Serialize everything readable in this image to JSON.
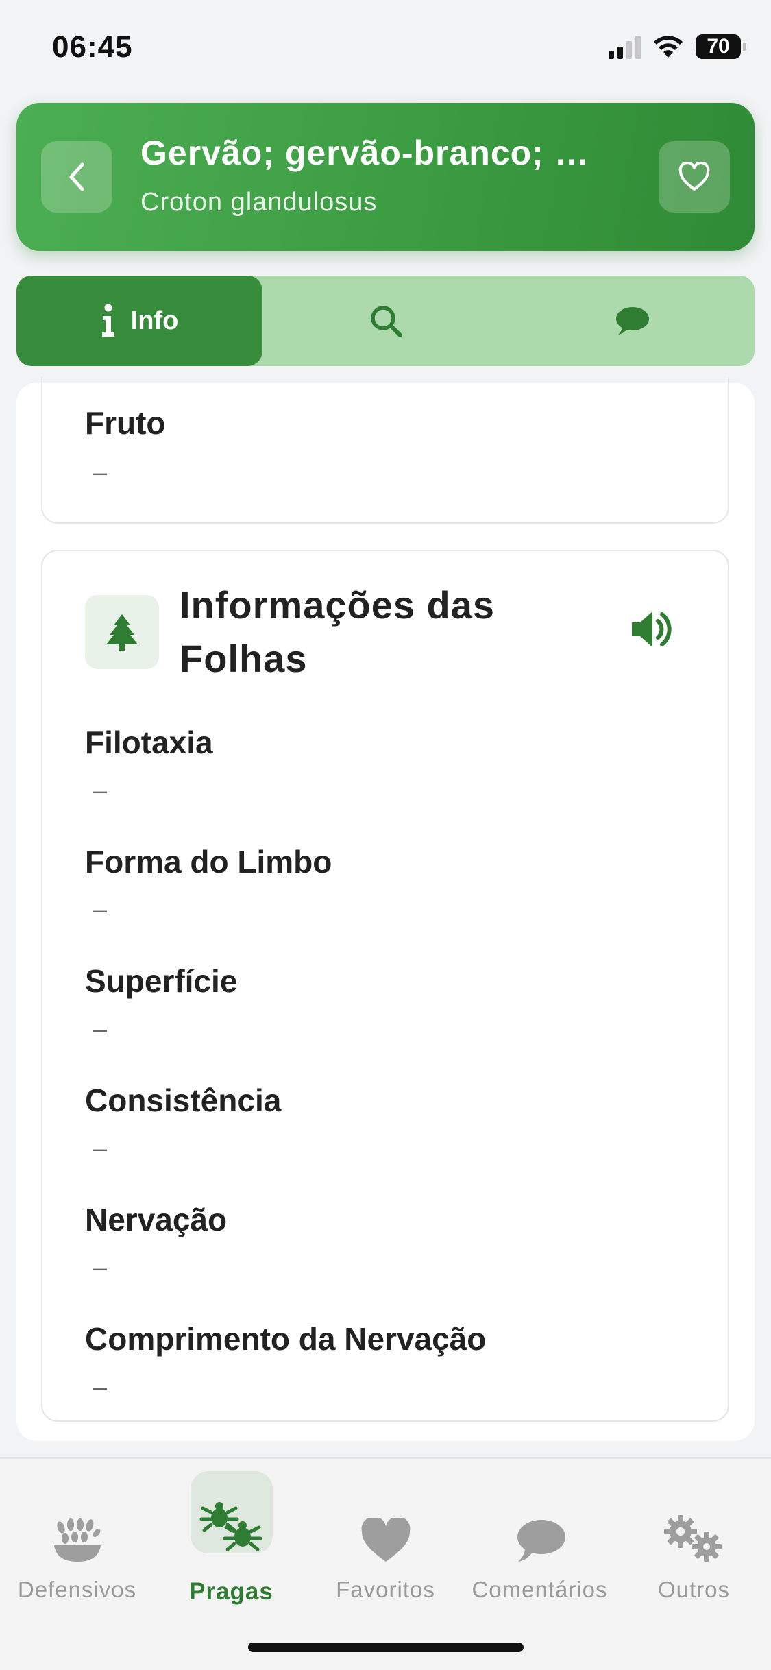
{
  "status_bar": {
    "time": "06:45",
    "battery": "70"
  },
  "header": {
    "title": "Gervão; gervão-branco; …",
    "subtitle": "Croton glandulosus"
  },
  "tabs": [
    {
      "label": "Info",
      "icon": "info-icon",
      "active": true
    },
    {
      "label": "",
      "icon": "search-icon",
      "active": false
    },
    {
      "label": "",
      "icon": "comment-icon",
      "active": false
    }
  ],
  "top_card": {
    "fields": [
      {
        "label": "Fruto",
        "value": "–"
      }
    ]
  },
  "leaves_card": {
    "title": "Informações das Folhas",
    "icon": "tree-icon",
    "fields": [
      {
        "label": "Filotaxia",
        "value": "–"
      },
      {
        "label": "Forma do Limbo",
        "value": "–"
      },
      {
        "label": "Superfície",
        "value": "–"
      },
      {
        "label": "Consistência",
        "value": "–"
      },
      {
        "label": "Nervação",
        "value": "–"
      },
      {
        "label": "Comprimento da Nervação",
        "value": "–"
      }
    ]
  },
  "bottom_nav": [
    {
      "label": "Defensivos",
      "icon": "seeds-icon",
      "active": false
    },
    {
      "label": "Pragas",
      "icon": "bugs-icon",
      "active": true
    },
    {
      "label": "Favoritos",
      "icon": "heart-icon",
      "active": false
    },
    {
      "label": "Comentários",
      "icon": "comment-icon",
      "active": false
    },
    {
      "label": "Outros",
      "icon": "gears-icon",
      "active": false
    }
  ],
  "colors": {
    "primary": "#388e3c",
    "primary_light": "#acdaad",
    "inactive": "#9a9a9a"
  }
}
